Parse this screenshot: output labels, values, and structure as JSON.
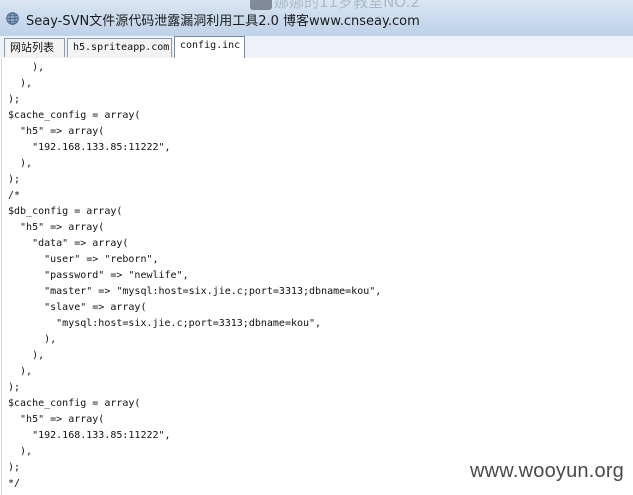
{
  "window": {
    "title": "Seay-SVN文件源代码泄露漏洞利用工具2.0  博客www.cnseay.com",
    "background_fragment": "娜娜的11岁教室NO.2"
  },
  "tabs": [
    {
      "label": "网站列表",
      "active": false
    },
    {
      "label": "h5.spriteapp.com",
      "active": false
    },
    {
      "label": "config.inc",
      "active": true
    }
  ],
  "code_lines": [
    "    ),",
    "  ),",
    ");",
    "$cache_config = array(",
    "  \"h5\" => array(",
    "    \"192.168.133.85:11222\",",
    "  ),",
    ");",
    "/*",
    "$db_config = array(",
    "  \"h5\" => array(",
    "    \"data\" => array(",
    "      \"user\" => \"reborn\",",
    "      \"password\" => \"newlife\",",
    "      \"master\" => \"mysql:host=six.jie.c;port=3313;dbname=kou\",",
    "      \"slave\" => array(",
    "        \"mysql:host=six.jie.c;port=3313;dbname=kou\",",
    "      ),",
    "    ),",
    "  ),",
    ");",
    "$cache_config = array(",
    "  \"h5\" => array(",
    "    \"192.168.133.85:11222\",",
    "  ),",
    ");",
    "*/"
  ],
  "watermark": "www.wooyun.org",
  "colors": {
    "titlebar": "#c8d9ec",
    "tab_border": "#8e9aa8",
    "text": "#111111"
  },
  "icons": {
    "app": "globe-icon"
  }
}
